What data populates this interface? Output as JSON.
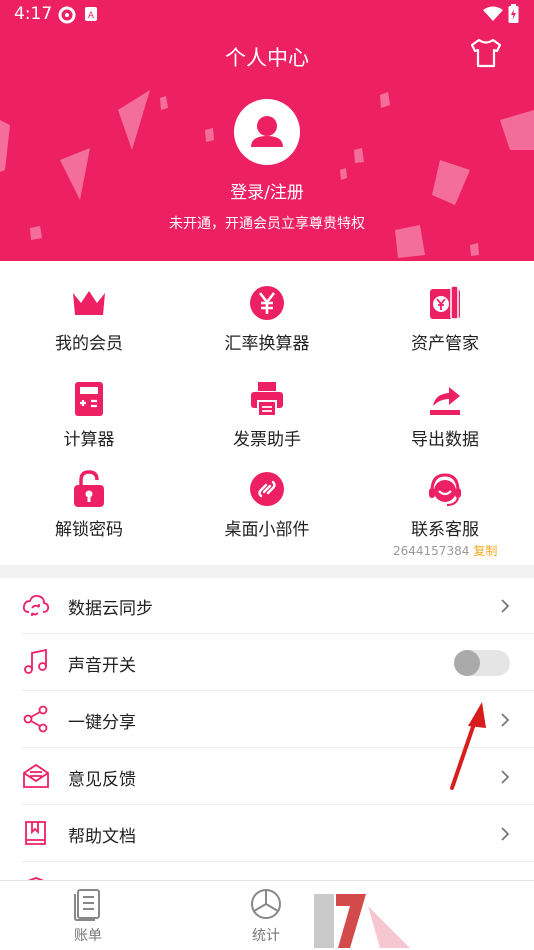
{
  "status": {
    "time": "4:17"
  },
  "header": {
    "title": "个人中心",
    "login": "登录/注册",
    "vip_tip": "未开通，开通会员立享尊贵特权",
    "bg_color": "#ee2064"
  },
  "grid": [
    {
      "label": "我的会员",
      "icon": "crown-icon"
    },
    {
      "label": "汇率换算器",
      "icon": "yen-coin-icon"
    },
    {
      "label": "资产管家",
      "icon": "wallet-icon"
    },
    {
      "label": "计算器",
      "icon": "calculator-icon"
    },
    {
      "label": "发票助手",
      "icon": "printer-icon"
    },
    {
      "label": "导出数据",
      "icon": "export-icon"
    },
    {
      "label": "解锁密码",
      "icon": "lock-icon"
    },
    {
      "label": "桌面小部件",
      "icon": "widget-icon"
    },
    {
      "label": "联系客服",
      "icon": "headset-icon"
    }
  ],
  "contact": {
    "number": "2644157384",
    "copy": "复制"
  },
  "list": [
    {
      "label": "数据云同步",
      "icon": "cloud-sync-icon",
      "control": "chevron"
    },
    {
      "label": "声音开关",
      "icon": "music-icon",
      "control": "toggle",
      "toggle_on": false
    },
    {
      "label": "一键分享",
      "icon": "share-icon",
      "control": "chevron"
    },
    {
      "label": "意见反馈",
      "icon": "mail-icon",
      "control": "chevron"
    },
    {
      "label": "帮助文档",
      "icon": "book-icon",
      "control": "chevron"
    }
  ],
  "nav": [
    {
      "label": "账单",
      "icon": "bill-icon"
    },
    {
      "label": "统计",
      "icon": "pie-chart-icon"
    }
  ],
  "colors": {
    "accent": "#ee2064",
    "annotation_arrow": "#d81c1c",
    "copy_link": "#f5a623"
  }
}
